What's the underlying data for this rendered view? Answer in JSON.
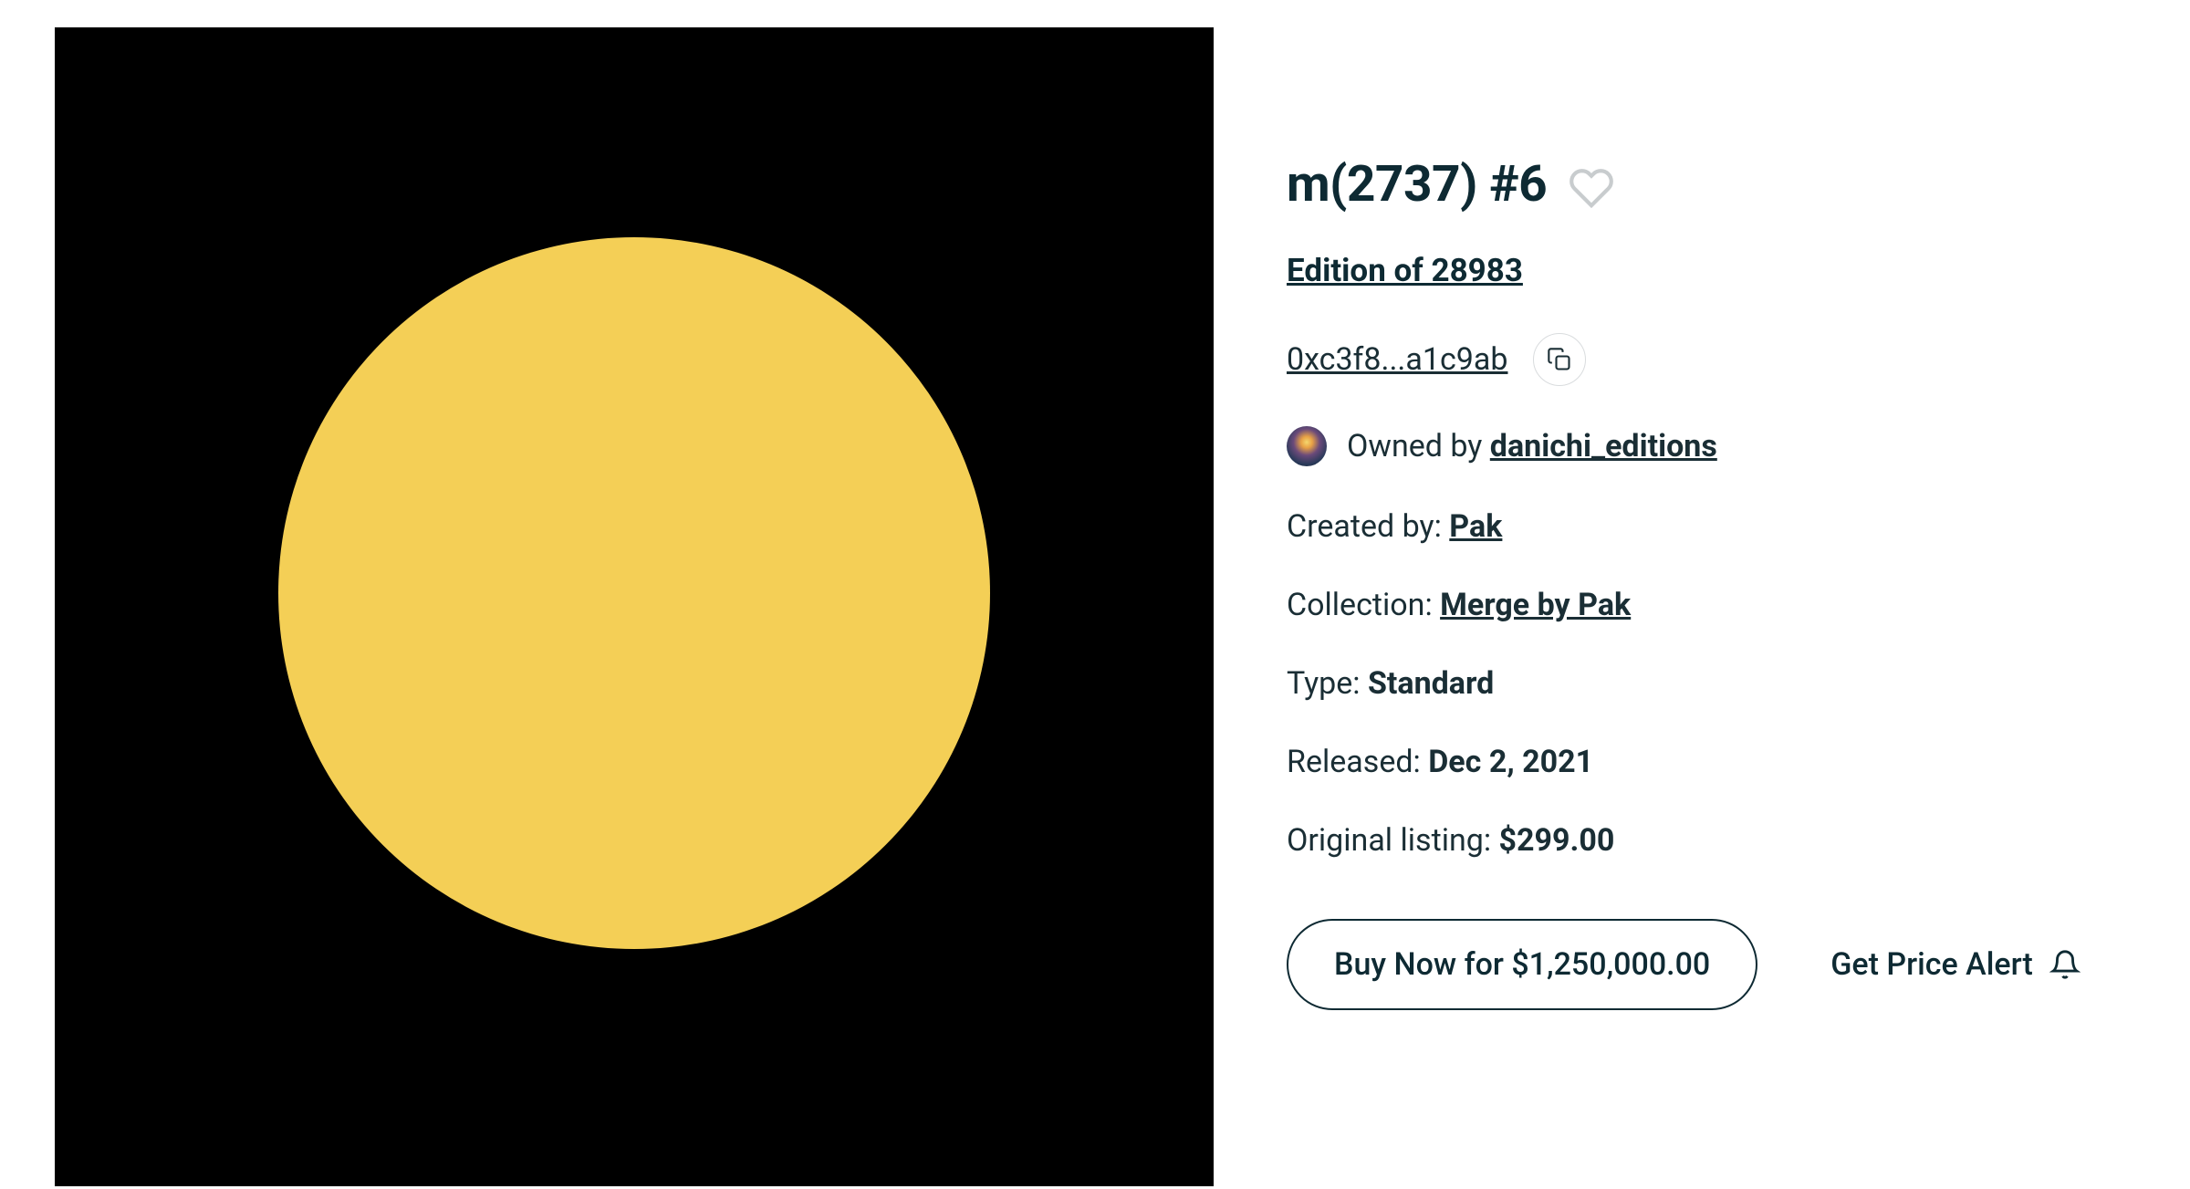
{
  "title": "m(2737) #6",
  "edition": {
    "label": "Edition of 28983"
  },
  "address": "0xc3f8...a1c9ab",
  "owner": {
    "prefix": "Owned by ",
    "name": "danichi_editions"
  },
  "creator": {
    "label": "Created by: ",
    "name": "Pak"
  },
  "collection": {
    "label": "Collection: ",
    "name": "Merge by Pak"
  },
  "type": {
    "label": "Type: ",
    "value": "Standard"
  },
  "released": {
    "label": "Released: ",
    "value": "Dec 2, 2021"
  },
  "original_listing": {
    "label": "Original listing: ",
    "value": "$299.00"
  },
  "actions": {
    "buy_label": "Buy Now for $1,250,000.00",
    "alert_label": "Get Price Alert"
  },
  "artwork": {
    "bg_color": "#000000",
    "circle_color": "#f4cf56"
  }
}
